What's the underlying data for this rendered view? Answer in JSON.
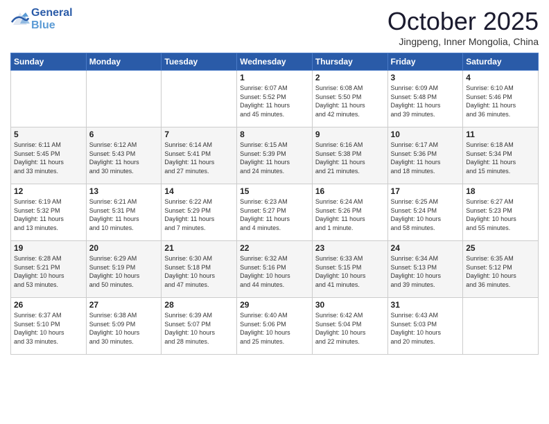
{
  "header": {
    "logo_line1": "General",
    "logo_line2": "Blue",
    "month_title": "October 2025",
    "location": "Jingpeng, Inner Mongolia, China"
  },
  "days_of_week": [
    "Sunday",
    "Monday",
    "Tuesday",
    "Wednesday",
    "Thursday",
    "Friday",
    "Saturday"
  ],
  "weeks": [
    [
      {
        "day": "",
        "info": ""
      },
      {
        "day": "",
        "info": ""
      },
      {
        "day": "",
        "info": ""
      },
      {
        "day": "1",
        "info": "Sunrise: 6:07 AM\nSunset: 5:52 PM\nDaylight: 11 hours\nand 45 minutes."
      },
      {
        "day": "2",
        "info": "Sunrise: 6:08 AM\nSunset: 5:50 PM\nDaylight: 11 hours\nand 42 minutes."
      },
      {
        "day": "3",
        "info": "Sunrise: 6:09 AM\nSunset: 5:48 PM\nDaylight: 11 hours\nand 39 minutes."
      },
      {
        "day": "4",
        "info": "Sunrise: 6:10 AM\nSunset: 5:46 PM\nDaylight: 11 hours\nand 36 minutes."
      }
    ],
    [
      {
        "day": "5",
        "info": "Sunrise: 6:11 AM\nSunset: 5:45 PM\nDaylight: 11 hours\nand 33 minutes."
      },
      {
        "day": "6",
        "info": "Sunrise: 6:12 AM\nSunset: 5:43 PM\nDaylight: 11 hours\nand 30 minutes."
      },
      {
        "day": "7",
        "info": "Sunrise: 6:14 AM\nSunset: 5:41 PM\nDaylight: 11 hours\nand 27 minutes."
      },
      {
        "day": "8",
        "info": "Sunrise: 6:15 AM\nSunset: 5:39 PM\nDaylight: 11 hours\nand 24 minutes."
      },
      {
        "day": "9",
        "info": "Sunrise: 6:16 AM\nSunset: 5:38 PM\nDaylight: 11 hours\nand 21 minutes."
      },
      {
        "day": "10",
        "info": "Sunrise: 6:17 AM\nSunset: 5:36 PM\nDaylight: 11 hours\nand 18 minutes."
      },
      {
        "day": "11",
        "info": "Sunrise: 6:18 AM\nSunset: 5:34 PM\nDaylight: 11 hours\nand 15 minutes."
      }
    ],
    [
      {
        "day": "12",
        "info": "Sunrise: 6:19 AM\nSunset: 5:32 PM\nDaylight: 11 hours\nand 13 minutes."
      },
      {
        "day": "13",
        "info": "Sunrise: 6:21 AM\nSunset: 5:31 PM\nDaylight: 11 hours\nand 10 minutes."
      },
      {
        "day": "14",
        "info": "Sunrise: 6:22 AM\nSunset: 5:29 PM\nDaylight: 11 hours\nand 7 minutes."
      },
      {
        "day": "15",
        "info": "Sunrise: 6:23 AM\nSunset: 5:27 PM\nDaylight: 11 hours\nand 4 minutes."
      },
      {
        "day": "16",
        "info": "Sunrise: 6:24 AM\nSunset: 5:26 PM\nDaylight: 11 hours\nand 1 minute."
      },
      {
        "day": "17",
        "info": "Sunrise: 6:25 AM\nSunset: 5:24 PM\nDaylight: 10 hours\nand 58 minutes."
      },
      {
        "day": "18",
        "info": "Sunrise: 6:27 AM\nSunset: 5:23 PM\nDaylight: 10 hours\nand 55 minutes."
      }
    ],
    [
      {
        "day": "19",
        "info": "Sunrise: 6:28 AM\nSunset: 5:21 PM\nDaylight: 10 hours\nand 53 minutes."
      },
      {
        "day": "20",
        "info": "Sunrise: 6:29 AM\nSunset: 5:19 PM\nDaylight: 10 hours\nand 50 minutes."
      },
      {
        "day": "21",
        "info": "Sunrise: 6:30 AM\nSunset: 5:18 PM\nDaylight: 10 hours\nand 47 minutes."
      },
      {
        "day": "22",
        "info": "Sunrise: 6:32 AM\nSunset: 5:16 PM\nDaylight: 10 hours\nand 44 minutes."
      },
      {
        "day": "23",
        "info": "Sunrise: 6:33 AM\nSunset: 5:15 PM\nDaylight: 10 hours\nand 41 minutes."
      },
      {
        "day": "24",
        "info": "Sunrise: 6:34 AM\nSunset: 5:13 PM\nDaylight: 10 hours\nand 39 minutes."
      },
      {
        "day": "25",
        "info": "Sunrise: 6:35 AM\nSunset: 5:12 PM\nDaylight: 10 hours\nand 36 minutes."
      }
    ],
    [
      {
        "day": "26",
        "info": "Sunrise: 6:37 AM\nSunset: 5:10 PM\nDaylight: 10 hours\nand 33 minutes."
      },
      {
        "day": "27",
        "info": "Sunrise: 6:38 AM\nSunset: 5:09 PM\nDaylight: 10 hours\nand 30 minutes."
      },
      {
        "day": "28",
        "info": "Sunrise: 6:39 AM\nSunset: 5:07 PM\nDaylight: 10 hours\nand 28 minutes."
      },
      {
        "day": "29",
        "info": "Sunrise: 6:40 AM\nSunset: 5:06 PM\nDaylight: 10 hours\nand 25 minutes."
      },
      {
        "day": "30",
        "info": "Sunrise: 6:42 AM\nSunset: 5:04 PM\nDaylight: 10 hours\nand 22 minutes."
      },
      {
        "day": "31",
        "info": "Sunrise: 6:43 AM\nSunset: 5:03 PM\nDaylight: 10 hours\nand 20 minutes."
      },
      {
        "day": "",
        "info": ""
      }
    ]
  ]
}
